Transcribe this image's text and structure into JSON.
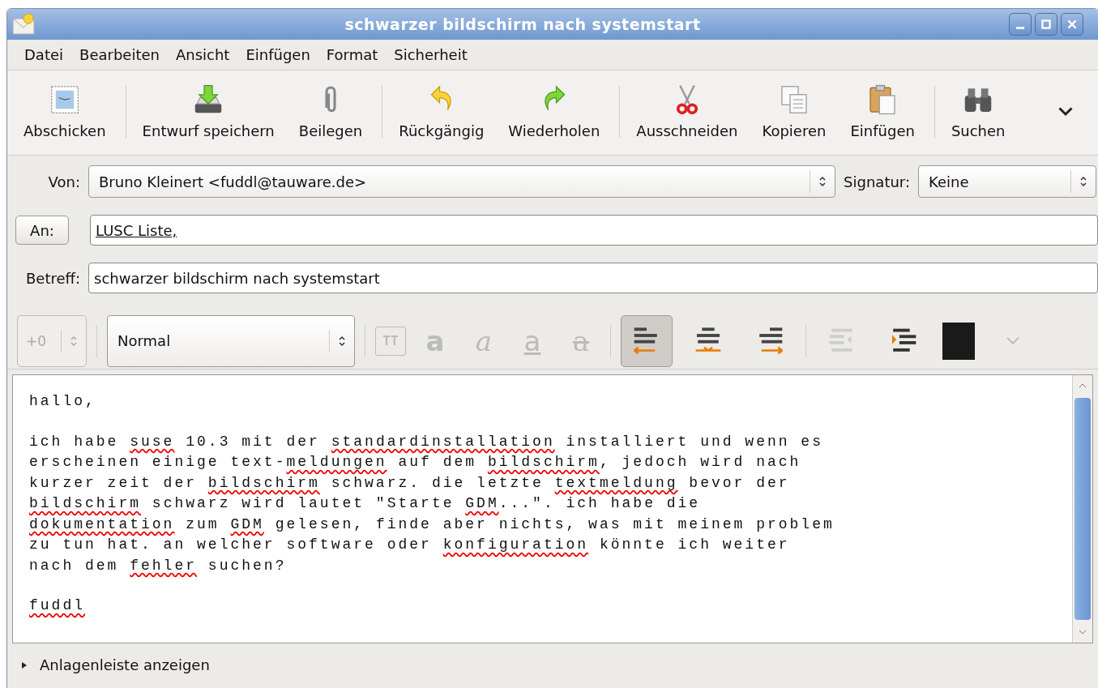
{
  "window": {
    "title": "schwarzer bildschirm nach systemstart"
  },
  "menu": [
    "Datei",
    "Bearbeiten",
    "Ansicht",
    "Einfügen",
    "Format",
    "Sicherheit"
  ],
  "toolbar": [
    [
      {
        "label": "Abschicken",
        "kind": "send"
      }
    ],
    [
      {
        "label": "Entwurf speichern",
        "kind": "save"
      },
      {
        "label": "Beilegen",
        "kind": "attach"
      }
    ],
    [
      {
        "label": "Rückgängig",
        "kind": "undo"
      },
      {
        "label": "Wiederholen",
        "kind": "redo"
      }
    ],
    [
      {
        "label": "Ausschneiden",
        "kind": "cut"
      },
      {
        "label": "Kopieren",
        "kind": "copy"
      },
      {
        "label": "Einfügen",
        "kind": "paste"
      }
    ],
    [
      {
        "label": "Suchen",
        "kind": "find"
      }
    ]
  ],
  "headers": {
    "from": {
      "label": "Von:",
      "value": "Bruno Kleinert <fuddl@tauware.de>"
    },
    "signature": {
      "label": "Signatur:",
      "value": "Keine"
    },
    "to": {
      "button": "An:",
      "value": "LUSC Liste,"
    },
    "subject": {
      "label": "Betreff:",
      "value": "schwarzer bildschirm nach systemstart"
    }
  },
  "format_bar": {
    "size": {
      "value": "+0",
      "disabled": true
    },
    "style": "Normal",
    "text_buttons": [
      {
        "kind": "teletype",
        "glyph": "TT",
        "disabled": true
      },
      {
        "kind": "bold",
        "glyph": "a",
        "disabled": true
      },
      {
        "kind": "italic",
        "glyph": "a",
        "disabled": true
      },
      {
        "kind": "underline",
        "glyph": "a",
        "disabled": true
      },
      {
        "kind": "strike",
        "glyph": "a",
        "disabled": true
      }
    ],
    "align_buttons": [
      {
        "kind": "left",
        "selected": true
      },
      {
        "kind": "center",
        "selected": false
      },
      {
        "kind": "right",
        "selected": false
      }
    ],
    "indent_buttons": [
      {
        "kind": "outdent",
        "disabled": true
      },
      {
        "kind": "indent",
        "disabled": false
      }
    ]
  },
  "body": [
    [
      [
        {
          "text": "hallo,",
          "misspelled": false
        }
      ]
    ],
    [
      [
        {
          "text": "ich habe ",
          "misspelled": false
        },
        {
          "text": "suse",
          "misspelled": true
        },
        {
          "text": " 10.3 mit der ",
          "misspelled": false
        },
        {
          "text": "standardinstallation",
          "misspelled": true
        },
        {
          "text": " installiert und wenn es",
          "misspelled": false
        }
      ],
      [
        {
          "text": "erscheinen einige text-",
          "misspelled": false
        },
        {
          "text": "meldungen",
          "misspelled": true
        },
        {
          "text": " auf dem ",
          "misspelled": false
        },
        {
          "text": "bildschirm",
          "misspelled": true
        },
        {
          "text": ", jedoch wird nach",
          "misspelled": false
        }
      ],
      [
        {
          "text": "kurzer zeit der ",
          "misspelled": false
        },
        {
          "text": "bildschirm",
          "misspelled": true
        },
        {
          "text": " schwarz. die letzte ",
          "misspelled": false
        },
        {
          "text": "textmeldung",
          "misspelled": true
        },
        {
          "text": " bevor der",
          "misspelled": false
        }
      ],
      [
        {
          "text": "bildschirm",
          "misspelled": true
        },
        {
          "text": " schwarz wird lautet \"Starte ",
          "misspelled": false
        },
        {
          "text": "GDM",
          "misspelled": true
        },
        {
          "text": "...\". ich habe die",
          "misspelled": false
        }
      ],
      [
        {
          "text": "dokumentation",
          "misspelled": true
        },
        {
          "text": " zum ",
          "misspelled": false
        },
        {
          "text": "GDM",
          "misspelled": true
        },
        {
          "text": " gelesen, finde aber nichts, was mit meinem problem",
          "misspelled": false
        }
      ],
      [
        {
          "text": "zu tun hat. an welcher software oder ",
          "misspelled": false
        },
        {
          "text": "konfiguration",
          "misspelled": true
        },
        {
          "text": " könnte ich weiter",
          "misspelled": false
        }
      ],
      [
        {
          "text": "nach dem ",
          "misspelled": false
        },
        {
          "text": "fehler",
          "misspelled": true
        },
        {
          "text": " suchen?",
          "misspelled": false
        }
      ]
    ],
    [
      [
        {
          "text": "fuddl",
          "misspelled": true
        }
      ]
    ]
  ],
  "attachments": {
    "label": "Anlagenleiste anzeigen",
    "expanded": false
  }
}
